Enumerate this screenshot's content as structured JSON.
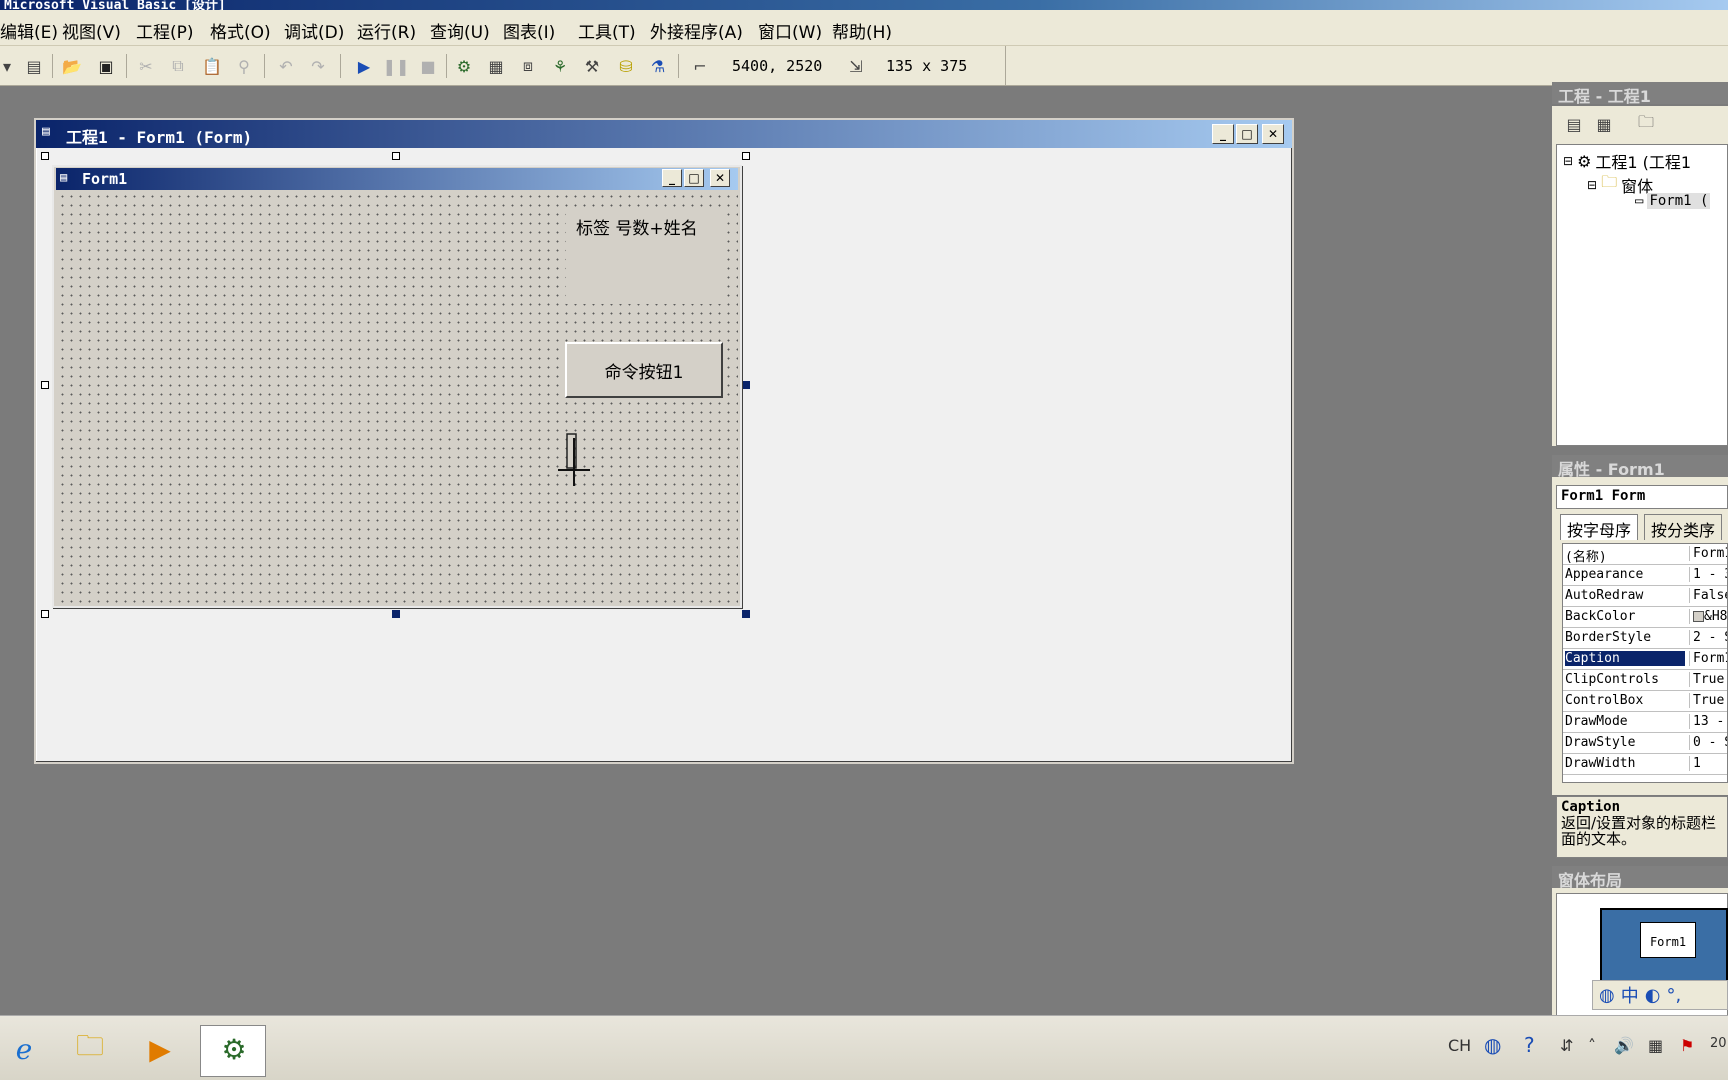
{
  "app": {
    "title": "Microsoft Visual Basic [设计]"
  },
  "menu": {
    "items": [
      "编辑(E)",
      "视图(V)",
      "工程(P)",
      "格式(O)",
      "调试(D)",
      "运行(R)",
      "查询(U)",
      "图表(I)",
      "工具(T)",
      "外接程序(A)",
      "窗口(W)",
      "帮助(H)"
    ]
  },
  "toolbar": {
    "position": "5400, 2520",
    "size": "135 x 375",
    "icons": [
      "dropdown-arrow-icon",
      "add-form-icon",
      "open-project-icon",
      "save-project-icon",
      "cut-icon",
      "copy-icon",
      "paste-icon",
      "find-icon",
      "undo-icon",
      "redo-icon",
      "start-icon",
      "break-icon",
      "end-icon",
      "project-explorer-icon",
      "properties-window-icon",
      "form-layout-icon",
      "object-browser-icon",
      "toolbox-icon",
      "data-view-icon",
      "component-manager-icon",
      "position-icon",
      "size-icon"
    ]
  },
  "designer": {
    "title": "工程1 - Form1 (Form)"
  },
  "form": {
    "title": "Form1",
    "label_caption": "标签 号数+姓名",
    "button_caption": "命令按钮1"
  },
  "project_panel": {
    "title": "工程 - 工程1",
    "tree": {
      "root": "工程1 (工程1",
      "folder": "窗体",
      "item": "Form1 ("
    }
  },
  "properties_panel": {
    "title": "属性 - Form1",
    "object": "Form1 Form",
    "tabs": [
      "按字母序",
      "按分类序"
    ],
    "rows": [
      {
        "name": "(名称)",
        "value": "Form1"
      },
      {
        "name": "Appearance",
        "value": "1 - 3"
      },
      {
        "name": "AutoRedraw",
        "value": "False"
      },
      {
        "name": "BackColor",
        "value": "&H8"
      },
      {
        "name": "BorderStyle",
        "value": "2 - S"
      },
      {
        "name": "Caption",
        "value": "Form1"
      },
      {
        "name": "ClipControls",
        "value": "True"
      },
      {
        "name": "ControlBox",
        "value": "True"
      },
      {
        "name": "DrawMode",
        "value": "13 -"
      },
      {
        "name": "DrawStyle",
        "value": "0 - S"
      },
      {
        "name": "DrawWidth",
        "value": "1"
      }
    ],
    "selected_index": 5,
    "description_title": "Caption",
    "description_text": "返回/设置对象的标题栏面的文本。"
  },
  "layout_panel": {
    "title": "窗体布局",
    "form_label": "Form1"
  },
  "taskbar": {
    "tray_lang": "CH",
    "clock": "20"
  },
  "colors": {
    "title_active": "#0a246a",
    "panel_bg": "#ece9d8",
    "workspace_bg": "#7b7b7b"
  }
}
